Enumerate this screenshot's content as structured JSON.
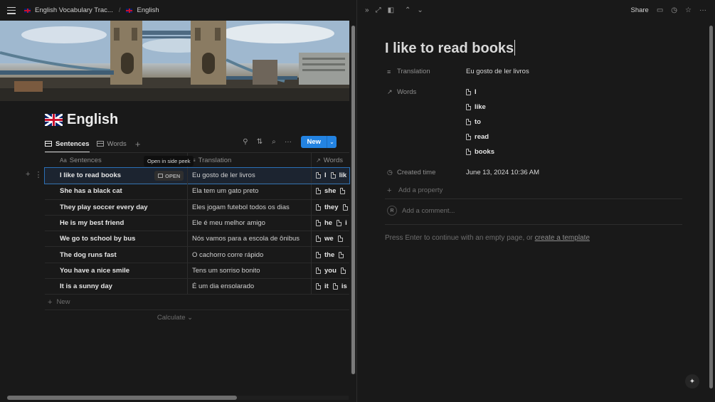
{
  "left": {
    "breadcrumb": [
      "English Vocabulary Trac...",
      "English"
    ],
    "breadcrumb_sep": "/",
    "page_title": "English",
    "views": [
      {
        "label": "Sentences",
        "active": true
      },
      {
        "label": "Words",
        "active": false
      }
    ],
    "add_view": "+",
    "toolbar": {
      "filter": "⚲",
      "sort": "⇅",
      "search": "⌕",
      "more": "···",
      "new_label": "New",
      "new_drop": "⌄"
    },
    "columns": {
      "sentences": "Sentences",
      "sentences_icon": "Aa",
      "translation": "Translation",
      "translation_icon": "≡",
      "words": "Words",
      "words_icon": "↗"
    },
    "tooltip": "Open in side peek",
    "open_label": "OPEN",
    "rows": [
      {
        "sentence": "I like to read books",
        "translation": "Eu gosto de ler livros",
        "words": [
          "I",
          "lik"
        ]
      },
      {
        "sentence": "She has a black cat",
        "translation": "Ela tem um gato preto",
        "words": [
          "she",
          ""
        ]
      },
      {
        "sentence": "They play soccer every day",
        "translation": "Eles jogam futebol todos os dias",
        "words": [
          "they",
          ""
        ]
      },
      {
        "sentence": "He is my best friend",
        "translation": "Ele é meu melhor amigo",
        "words": [
          "he",
          "i"
        ]
      },
      {
        "sentence": "We go to school by bus",
        "translation": "Nós vamos para a escola de ônibus",
        "words": [
          "we",
          ""
        ]
      },
      {
        "sentence": "The dog runs fast",
        "translation": "O cachorro corre rápido",
        "words": [
          "the",
          ""
        ]
      },
      {
        "sentence": "You have a nice smile",
        "translation": "Tens um sorriso bonito",
        "words": [
          "you",
          ""
        ]
      },
      {
        "sentence": "It is a sunny day",
        "translation": "É um dia ensolarado",
        "words": [
          "it",
          "is"
        ]
      }
    ],
    "new_row": "New",
    "calculate": "Calculate ⌄"
  },
  "right": {
    "share": "Share",
    "title": "I like to read books",
    "props": {
      "translation_label": "Translation",
      "translation_value": "Eu gosto de ler livros",
      "words_label": "Words",
      "words": [
        "I",
        "like",
        "to",
        "read",
        "books"
      ],
      "created_label": "Created time",
      "created_value": "June 13, 2024 10:36 AM",
      "add_property": "Add a property"
    },
    "comment_placeholder": "Add a comment...",
    "avatar_initial": "R",
    "hint_prefix": "Press Enter to continue with an empty page, or ",
    "hint_link": "create a template"
  }
}
